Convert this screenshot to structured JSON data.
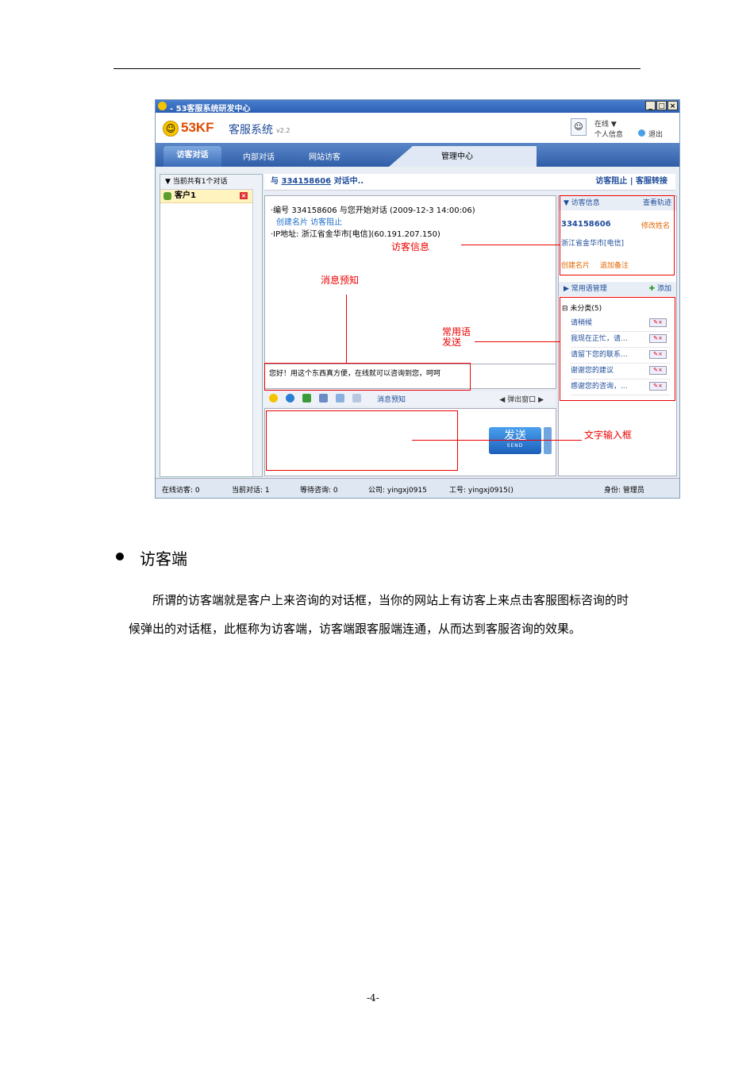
{
  "window": {
    "title": "- 53客服系统研发中心",
    "controls": [
      "_",
      "□",
      "×"
    ],
    "brand": "53KF",
    "product": "客服系统",
    "version": "v2.2",
    "status": "在线",
    "profile": "个人信息",
    "logout": "退出",
    "tabs": [
      "访客对话",
      "内部对话",
      "网站访客",
      "管理中心"
    ],
    "left": {
      "header": "▼ 当前共有1个对话",
      "client": "客户1"
    },
    "chat_header": {
      "prefix": "与",
      "visitor_id": "334158606",
      "suffix": "对话中..",
      "actions": "访客阻止 | 客服转接"
    },
    "chat": {
      "line1": "·编号 334158606 与您开始对话 (2009-12-3 14:00:06)",
      "line2": "创建名片  访客阻止",
      "line3": "·IP地址: 浙江省金华市[电信](60.191.207.150)"
    },
    "presend_text": "您好！用这个东西真方便，在线就可以咨询到您，呵呵",
    "toolbar": {
      "preview": "消息预知",
      "popup": "◀ 弹出窗口 ▶"
    },
    "send": {
      "label": "发送",
      "sub": "SEND"
    },
    "visitor_info": {
      "header": "▼ 访客信息",
      "track": "查看轨迹",
      "id": "334158606",
      "rename": "修改姓名",
      "location": "浙江省金华市[电信]",
      "create_card": "创建名片",
      "add_note": "追加备注"
    },
    "phrases": {
      "header": "▶ 常用语管理",
      "add": "添加",
      "category": "⊟ 未分类(5)",
      "items": [
        "请稍候",
        "我现在正忙，请...",
        "请留下您的联系...",
        "谢谢您的建议",
        "感谢您的咨询，..."
      ]
    },
    "statusbar": [
      "在线访客: 0",
      "当前对话: 1",
      "等待咨询: 0",
      "公司: yingxj0915",
      "工号: yingxj0915()",
      "身份: 管理员"
    ],
    "annotations": {
      "visitor_info": "访客信息",
      "preview": "消息预知",
      "phrase_send": "常用语\n发送",
      "input_box": "文字输入框"
    }
  },
  "section": {
    "heading": "访客端",
    "paragraph": "所谓的访客端就是客户上来咨询的对话框，当你的网站上有访客上来点击客服图标咨询的时候弹出的对话框，此框称为访客端，访客端跟客服端连通，从而达到客服咨询的效果。"
  },
  "page_number": "-4-"
}
